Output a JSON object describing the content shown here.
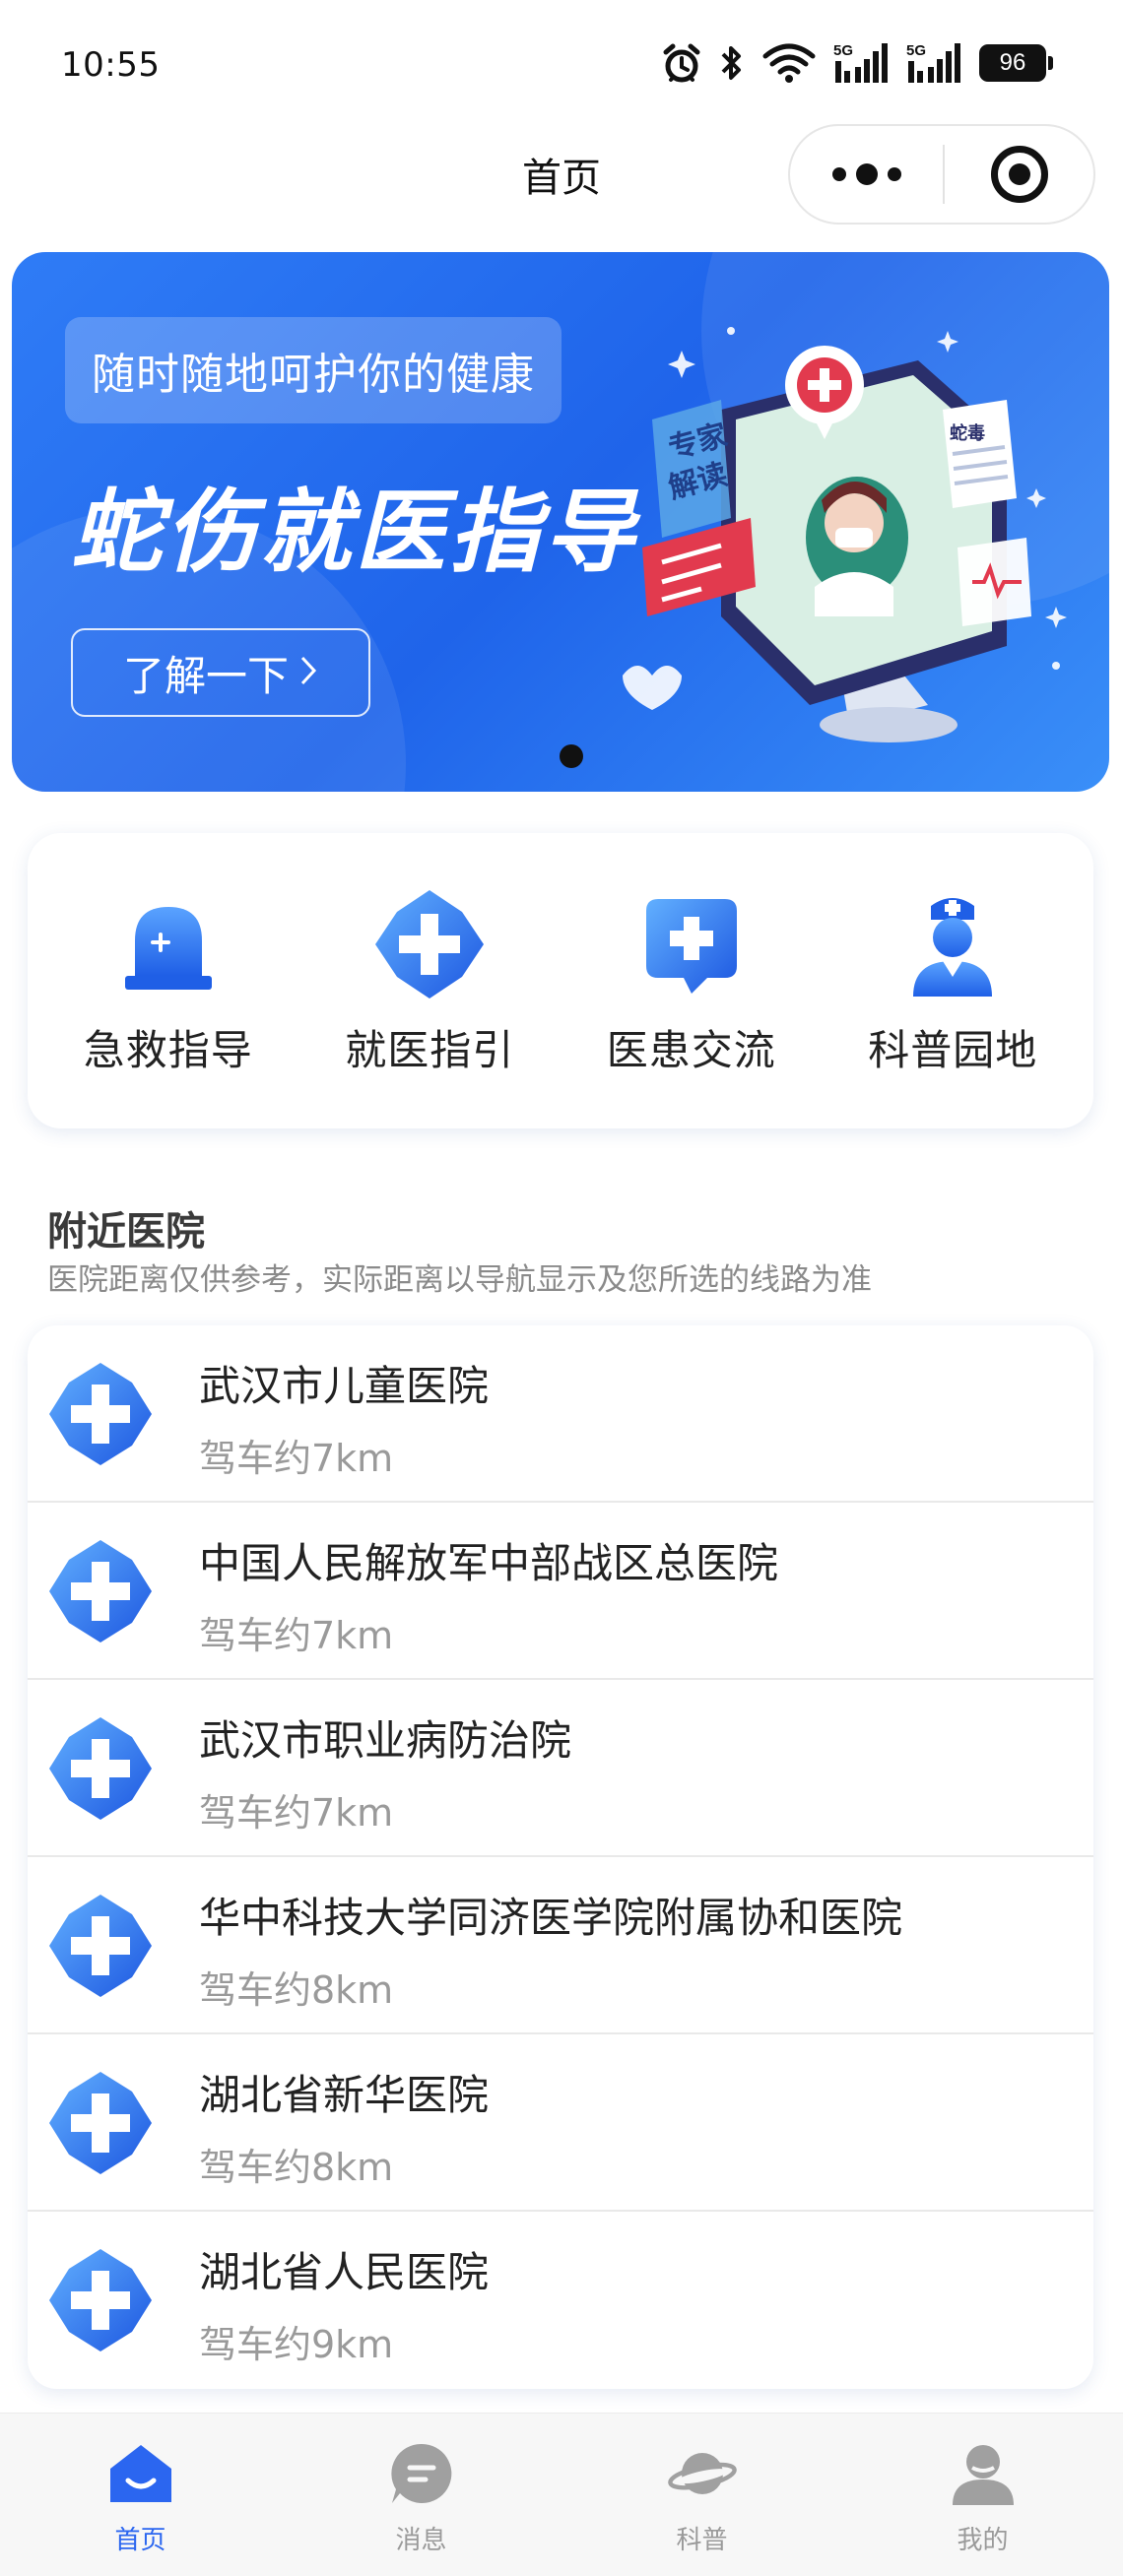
{
  "status_bar": {
    "time": "10:55",
    "battery": "96",
    "network_1": "5G",
    "network_2": "5G"
  },
  "nav": {
    "title": "首页"
  },
  "banner": {
    "tag": "随时随地呵护你的健康",
    "title": "蛇伤就医指导",
    "button": "了解一下",
    "art_text_1": "专家",
    "art_text_2": "解读",
    "art_text_3": "蛇毒"
  },
  "quick_menu": [
    {
      "label": "急救指导",
      "icon": "siren-icon"
    },
    {
      "label": "就医指引",
      "icon": "medical-cross-icon"
    },
    {
      "label": "医患交流",
      "icon": "chat-cross-icon"
    },
    {
      "label": "科普园地",
      "icon": "nurse-icon"
    }
  ],
  "nearby": {
    "title": "附近医院",
    "subtitle": "医院距离仅供参考，实际距离以导航显示及您所选的线路为准",
    "hospitals": [
      {
        "name": "武汉市儿童医院",
        "distance": "驾车约7km"
      },
      {
        "name": "中国人民解放军中部战区总医院",
        "distance": "驾车约7km"
      },
      {
        "name": "武汉市职业病防治院",
        "distance": "驾车约7km"
      },
      {
        "name": "华中科技大学同济医学院附属协和医院",
        "distance": "驾车约8km"
      },
      {
        "name": "湖北省新华医院",
        "distance": "驾车约8km"
      },
      {
        "name": "湖北省人民医院",
        "distance": "驾车约9km"
      }
    ]
  },
  "tabs": [
    {
      "label": "首页",
      "icon": "home-icon",
      "active": true
    },
    {
      "label": "消息",
      "icon": "message-icon",
      "active": false
    },
    {
      "label": "科普",
      "icon": "planet-icon",
      "active": false
    },
    {
      "label": "我的",
      "icon": "user-icon",
      "active": false
    }
  ],
  "colors": {
    "primary": "#2b66f0",
    "banner": "#2f7cf6",
    "tab_inactive": "#9a9a9a"
  }
}
